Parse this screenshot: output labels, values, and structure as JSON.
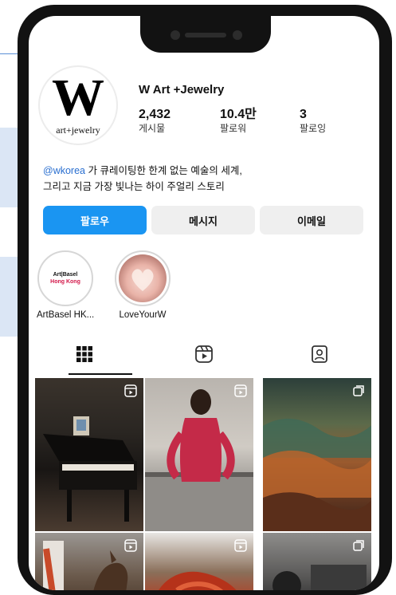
{
  "profile": {
    "name": "W Art +Jewelry",
    "avatar_text": "W",
    "avatar_subtext": "art+jewelry",
    "stats": [
      {
        "value": "2,432",
        "label": "게시물"
      },
      {
        "value": "10.4만",
        "label": "팔로워"
      },
      {
        "value": "3",
        "label": "팔로잉"
      }
    ],
    "bio_handle": "@wkorea",
    "bio_line1_rest": " 가 큐레이팅한 한계 없는 예술의 세계,",
    "bio_line2": "그리고 지금 가장 빛나는 하이 주얼리 스토리"
  },
  "buttons": {
    "follow": "팔로우",
    "message": "메시지",
    "email": "이메일"
  },
  "highlights": [
    {
      "label": "ArtBasel HK...",
      "logo_line1": "Art|Basel",
      "logo_line2": "Hong Kong"
    },
    {
      "label": "LoveYourW"
    }
  ],
  "tabs": [
    {
      "icon": "grid-icon",
      "active": true
    },
    {
      "icon": "reels-icon",
      "active": false
    },
    {
      "icon": "tagged-icon",
      "active": false
    }
  ],
  "posts": [
    {
      "badge": "reel-icon"
    },
    {
      "badge": "reel-icon"
    },
    {
      "badge": "carousel-icon"
    },
    {
      "badge": "reel-icon"
    },
    {
      "badge": "reel-icon"
    },
    {
      "badge": "carousel-icon"
    }
  ],
  "colors": {
    "follow_button": "#1a95f2",
    "secondary_button": "#efefef",
    "handle_link": "#2a6fd0",
    "phone_frame": "#121212"
  }
}
